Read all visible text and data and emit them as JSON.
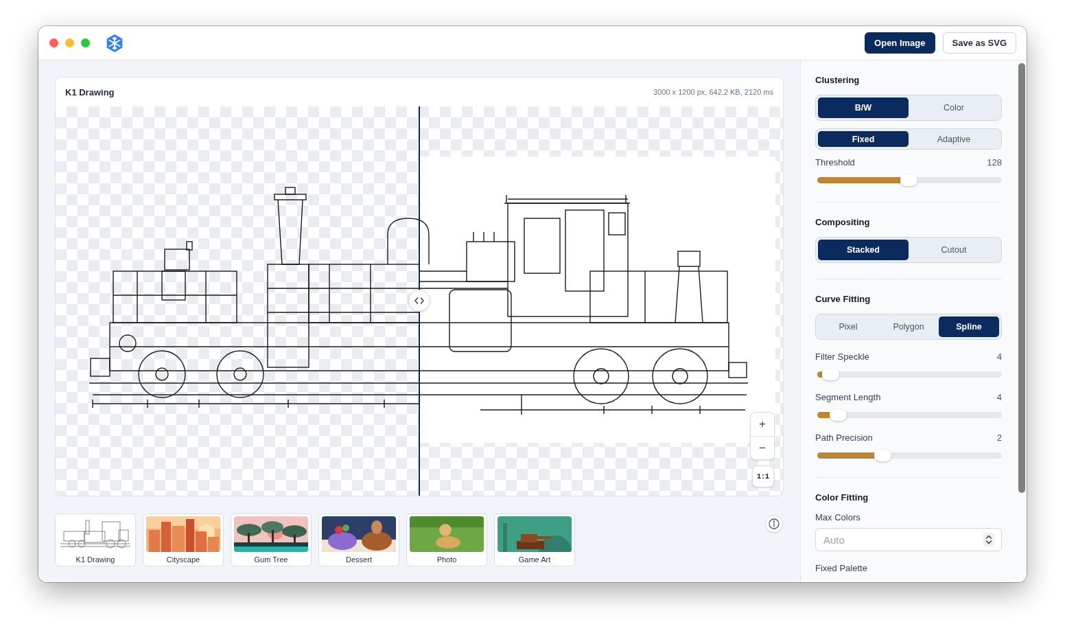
{
  "window": {
    "controls": [
      {
        "color": "#ff5f57"
      },
      {
        "color": "#febc2e"
      },
      {
        "color": "#28c840"
      }
    ]
  },
  "toolbar": {
    "buttons": [
      {
        "label": "Open Image",
        "kind": "primary"
      },
      {
        "label": "Save as SVG",
        "kind": "secondary"
      }
    ]
  },
  "preview": {
    "title": "K1 Drawing",
    "info": "3000 x 1200 px, 642.2 KB, 2120 ms",
    "compare": {
      "level": 0.5
    },
    "zoom_buttons": [
      {
        "kind": "zoom_in",
        "label": "+"
      },
      {
        "kind": "zoom_out",
        "label": "−"
      },
      {
        "kind": "reset",
        "label": "1:1"
      }
    ]
  },
  "samples": [
    {
      "label": "K1 Drawing",
      "kind": "lineart"
    },
    {
      "label": "Cityscape",
      "kind": "cityscape"
    },
    {
      "label": "Gum Tree",
      "kind": "landscape"
    },
    {
      "label": "Dessert",
      "kind": "food"
    },
    {
      "label": "Photo",
      "kind": "photo"
    },
    {
      "label": "Game Art",
      "kind": "pixelart"
    }
  ],
  "settings": {
    "sections": [
      {
        "title": "Clustering",
        "controls": [
          {
            "kind": "segmented",
            "options": [
              {
                "label": "B/W",
                "selected": true
              },
              {
                "label": "Color",
                "selected": false
              }
            ]
          },
          {
            "kind": "segmented_compact",
            "options": [
              {
                "label": "Fixed",
                "selected": true
              },
              {
                "label": "Adaptive",
                "selected": false
              }
            ]
          },
          {
            "kind": "slider",
            "label": "Threshold",
            "reading": "128",
            "level": 0.5
          }
        ]
      },
      {
        "title": "Compositing",
        "controls": [
          {
            "kind": "segmented",
            "options": [
              {
                "label": "Stacked",
                "selected": true
              },
              {
                "label": "Cutout",
                "selected": false
              }
            ]
          }
        ]
      },
      {
        "title": "Curve Fitting",
        "controls": [
          {
            "kind": "segmented",
            "options": [
              {
                "label": "Pixel",
                "selected": false
              },
              {
                "label": "Polygon",
                "selected": false
              },
              {
                "label": "Spline",
                "selected": true
              }
            ]
          },
          {
            "kind": "slider",
            "label": "Filter Speckle",
            "reading": "4",
            "level": 0.08
          },
          {
            "kind": "slider",
            "label": "Segment Length",
            "reading": "4",
            "level": 0.12
          },
          {
            "kind": "slider",
            "label": "Path Precision",
            "reading": "2",
            "level": 0.36
          }
        ]
      },
      {
        "title": "Color Fitting",
        "controls": [
          {
            "kind": "select",
            "label": "Max Colors",
            "placeholder": "Auto"
          },
          {
            "kind": "label",
            "label": "Fixed Palette"
          }
        ]
      }
    ]
  }
}
